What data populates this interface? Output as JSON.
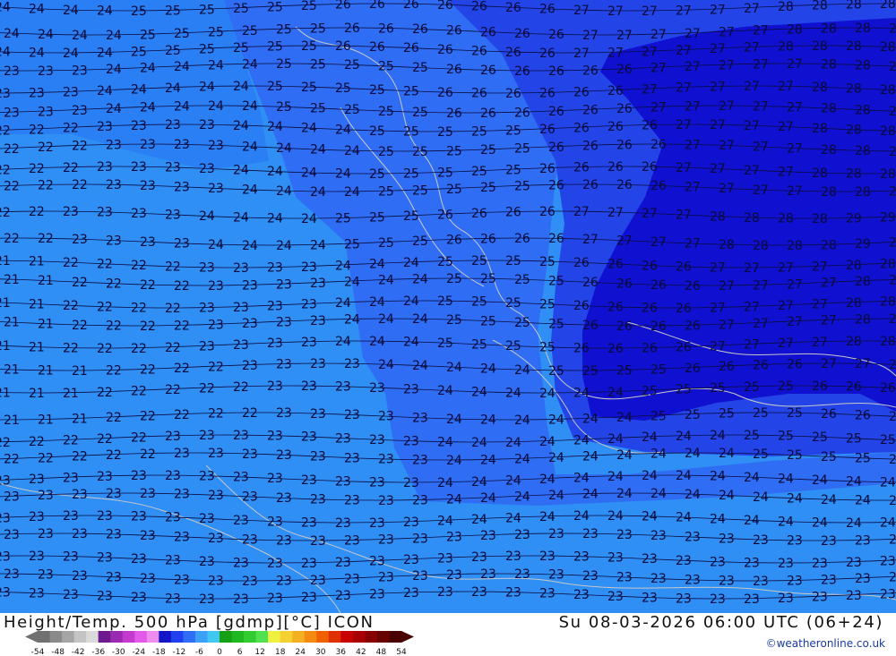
{
  "map": {
    "contour_values": [
      "21",
      "22",
      "23",
      "24",
      "25",
      "26",
      "27",
      "28",
      "29"
    ],
    "colors": {
      "field_23": "#2f8ff5",
      "field_25": "#2f6ef4",
      "field_27": "#2345e8",
      "field_28": "#1010d0",
      "contour_line": "#0b0b40",
      "coast_line": "#c8c8c8"
    }
  },
  "footer": {
    "title": "Height/Temp. 500 hPa [gdmp][°C] ICON",
    "valid_time": "Su 08-03-2026 06:00 UTC (06+24)",
    "credit": "©weatheronline.co.uk"
  },
  "legend": {
    "ticks": [
      "-54",
      "-48",
      "-42",
      "-36",
      "-30",
      "-24",
      "-18",
      "-12",
      "-6",
      "0",
      "6",
      "12",
      "18",
      "24",
      "30",
      "36",
      "42",
      "48",
      "54"
    ],
    "colors": [
      "#707070",
      "#8a8a8a",
      "#a5a5a5",
      "#c4c4c4",
      "#dadada",
      "#6e1a8c",
      "#9a2ab0",
      "#c43ad0",
      "#e45ae8",
      "#f08cf0",
      "#1515c8",
      "#2040f0",
      "#2f6ef4",
      "#3ca0f8",
      "#40c8f0",
      "#15a015",
      "#20b820",
      "#30cc30",
      "#50e050",
      "#f0f040",
      "#f4d030",
      "#f4b020",
      "#f48a10",
      "#f06000",
      "#e03000",
      "#c80000",
      "#a80000",
      "#880000",
      "#680000",
      "#480000"
    ]
  }
}
